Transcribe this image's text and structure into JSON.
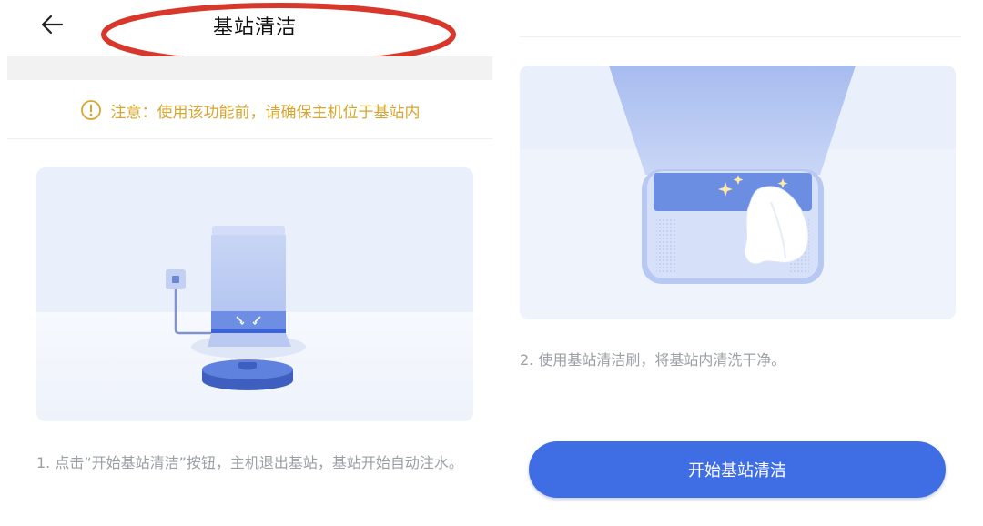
{
  "header": {
    "title": "基站清洁",
    "back_icon": "arrow-left-icon"
  },
  "notice": {
    "icon": "warning-circle-icon",
    "text": "注意：使用该功能前，请确保主机位于基站内",
    "color": "#d7a630"
  },
  "steps": [
    {
      "text": "1. 点击“开始基站清洁”按钮，主机退出基站，基站开始自动注水。"
    },
    {
      "text": "2. 使用基站清洁刷，将基站内清洗干净。"
    }
  ],
  "actions": {
    "start_label": "开始基站清洁",
    "accent": "#3f6ee4"
  },
  "annotation": {
    "color": "#d8382c"
  }
}
